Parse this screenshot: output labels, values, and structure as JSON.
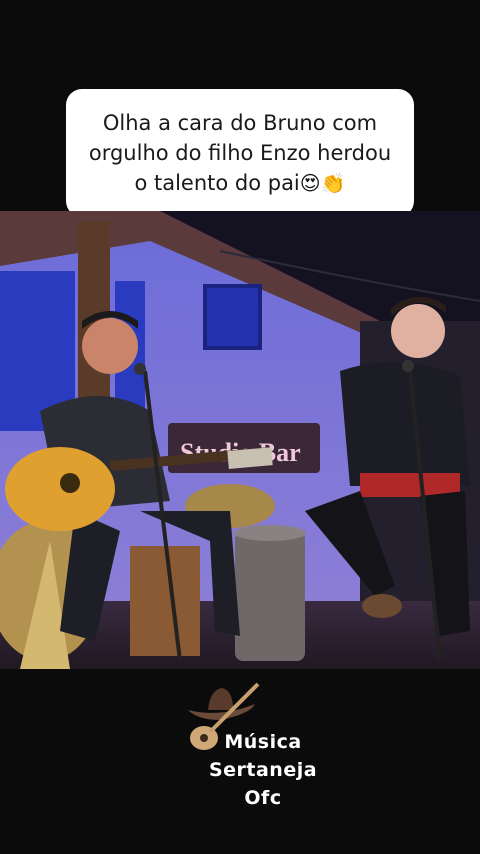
{
  "caption": {
    "line1": "Olha a cara do Bruno  com",
    "line2": "orgulho do filho Enzo herdou",
    "line3": "o talento do pai",
    "emojis": "😍👏"
  },
  "scene": {
    "sign_text": "Studio Bar"
  },
  "brand": {
    "line1": "Música",
    "line2": "Sertaneja",
    "line3": "Ofc",
    "icon": "guitar-cowboy-hat-icon"
  }
}
